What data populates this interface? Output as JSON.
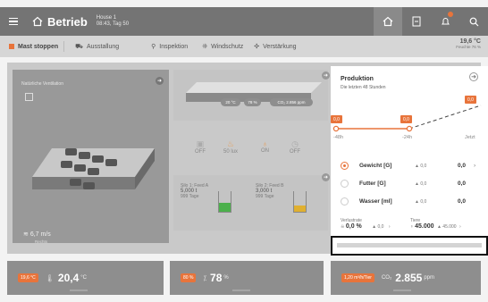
{
  "header": {
    "brand": "Betrieb",
    "house": "House 1",
    "time": "08:43, Tag 50"
  },
  "actions": {
    "stop": "Mast stoppen",
    "items": [
      "Ausstallung",
      "Inspektion",
      "Windschutz",
      "Verstärkung"
    ],
    "temp": "19,6 °C",
    "humidity": "Feuchte 76 %"
  },
  "ventilation": {
    "title": "Natürliche Ventilation",
    "wind": "6,7 m/s",
    "direction": "Rechts"
  },
  "climate": {
    "temp": "20 °C",
    "humidity": "78 %",
    "co2": "CO₂ 2.856 ppm"
  },
  "status": [
    {
      "label": "OFF"
    },
    {
      "label": "50 lux"
    },
    {
      "label": "ON"
    },
    {
      "label": "OFF"
    }
  ],
  "silos": [
    {
      "name": "Silo 1: Feed A",
      "amount": "5,000 t",
      "days": "999 Tage",
      "color": "#4cb04c"
    },
    {
      "name": "Silo 2: Feed B",
      "amount": "3,000 t",
      "days": "999 Tage",
      "color": "#e0b030"
    }
  ],
  "production": {
    "title": "Produktion",
    "subtitle": "Die letzten 48 Stunden",
    "chips": [
      "0,0",
      "0,0",
      "0,0"
    ],
    "timeline": [
      "-48h",
      "-24h",
      "Jetzt"
    ],
    "rows": [
      {
        "label": "Gewicht [G]",
        "delta": "▲ 0,0",
        "value": "0,0",
        "selected": true
      },
      {
        "label": "Futter [G]",
        "delta": "▲ 0,0",
        "value": "0,0",
        "selected": false
      },
      {
        "label": "Wasser [ml]",
        "delta": "▲ 0,0",
        "value": "0,0",
        "selected": false
      }
    ],
    "loss": {
      "label": "Verlustrate",
      "value": "0,0 %",
      "delta": "▲ 0,0"
    },
    "animals": {
      "label": "Tiere",
      "value": "45.000",
      "delta": "▲ 45.000"
    }
  },
  "bottom": [
    {
      "chip": "19,6 °C",
      "value": "20,4",
      "unit": "°C"
    },
    {
      "chip": "80 %",
      "value": "78",
      "unit": "%"
    },
    {
      "chip": "1,20 m³/h/Tier",
      "label": "CO₂",
      "value": "2.855",
      "unit": "ppm"
    }
  ],
  "colors": {
    "accent": "#e8743b",
    "topbar": "#747474"
  }
}
